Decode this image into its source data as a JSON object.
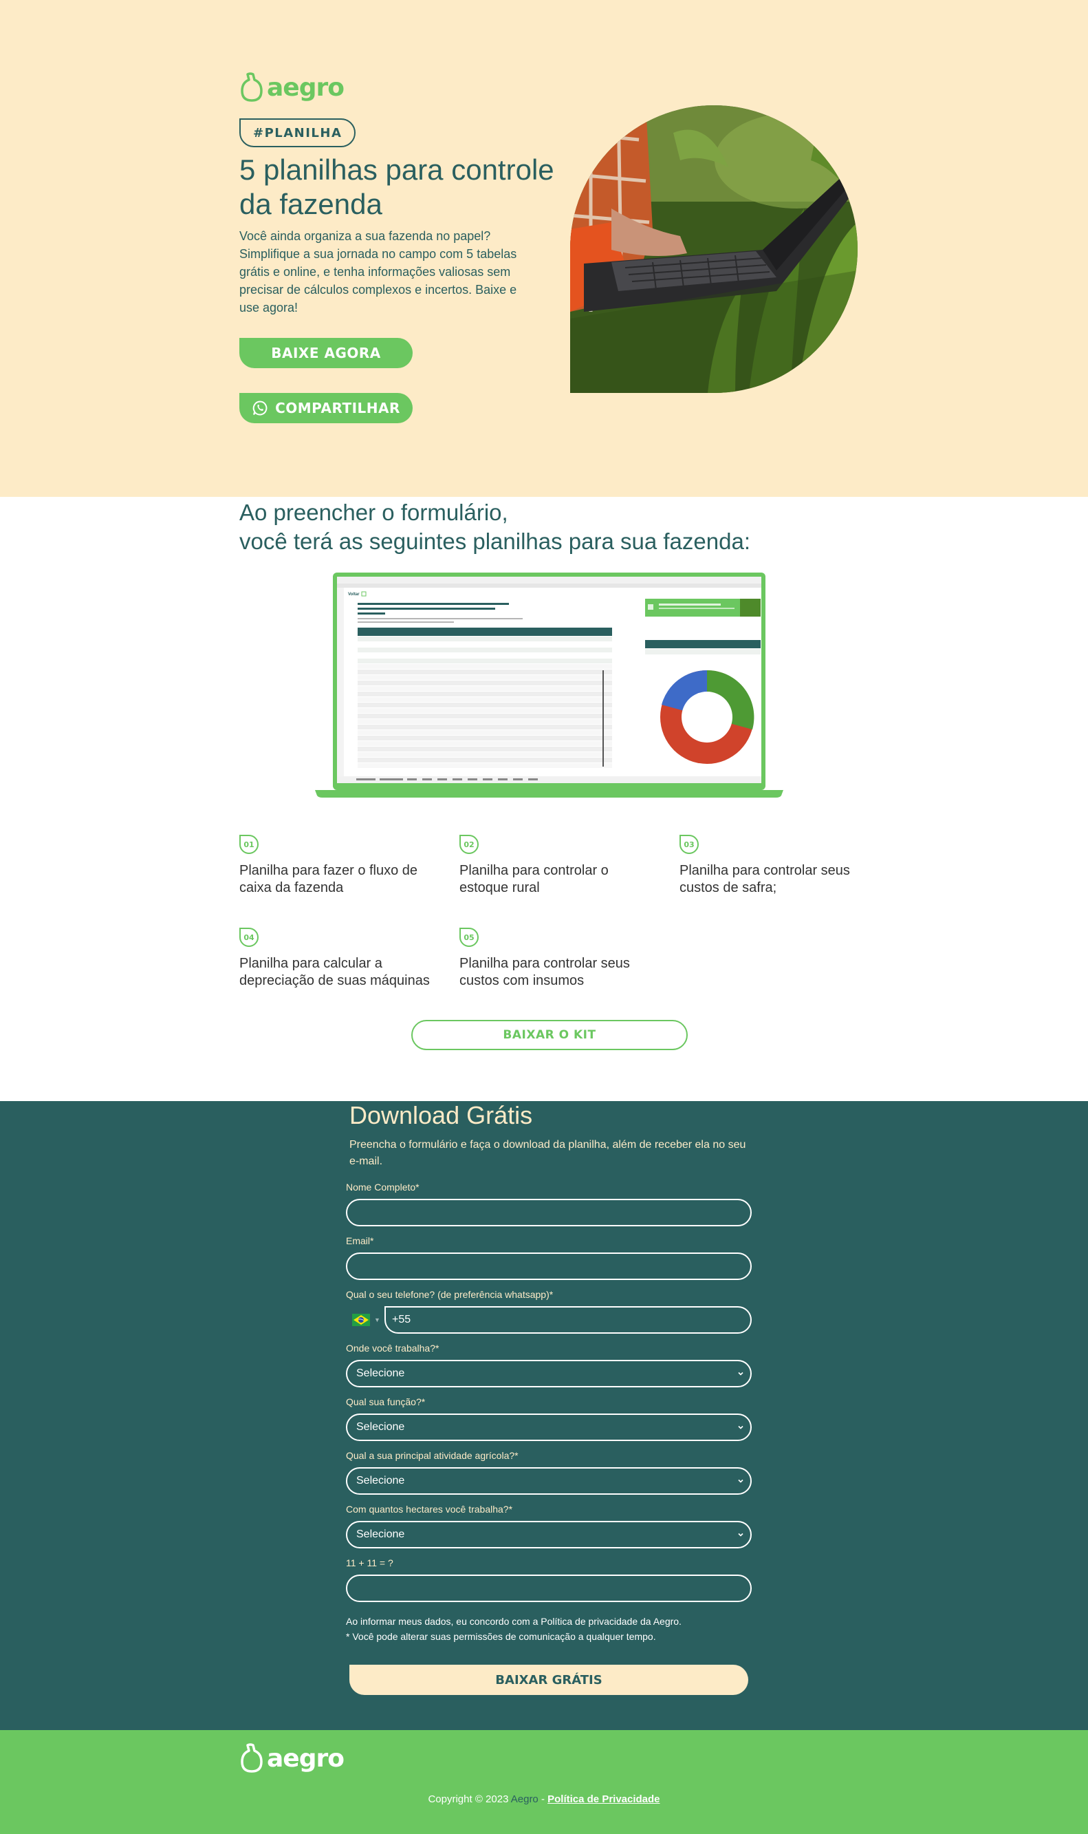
{
  "hero": {
    "logo": "aegro",
    "badge": "#PLANILHA",
    "title": "5 planilhas para controle da fazenda",
    "description": "Você ainda organiza a sua fazenda no papel? Simplifique a sua jornada no campo com 5 tabelas grátis e online, e tenha informações valiosas sem precisar de cálculos complexos e incertos. Baixe e use agora!",
    "download_button": "BAIXE AGORA",
    "share_button": "COMPARTILHAR"
  },
  "planilhas": {
    "title_line1": "Ao preencher o formulário,",
    "title_line2": "você terá as seguintes planilhas para sua fazenda:",
    "items": [
      {
        "num": "01",
        "text": "Planilha para fazer o fluxo de caixa da fazenda"
      },
      {
        "num": "02",
        "text": "Planilha para controlar o estoque rural"
      },
      {
        "num": "03",
        "text": "Planilha para controlar seus custos de safra;"
      },
      {
        "num": "04",
        "text": "Planilha para calcular a depreciação de suas máquinas"
      },
      {
        "num": "05",
        "text": "Planilha para controlar seus custos com insumos"
      }
    ],
    "kit_button": "BAIXAR O KIT"
  },
  "form": {
    "title": "Download Grátis",
    "description": "Preencha o formulário e faça o download da planilha, além de receber ela no seu e-mail.",
    "name_label": "Nome Completo*",
    "email_label": "Email*",
    "phone_label": "Qual o seu telefone? (de preferência whatsapp)*",
    "phone_value": "+55",
    "work_label": "Onde você trabalha?*",
    "role_label": "Qual sua função?*",
    "activity_label": "Qual a sua principal atividade agrícola?*",
    "hectares_label": "Com quantos hectares você trabalha?*",
    "select_placeholder": "Selecione",
    "captcha_label": "11 + 11 = ?",
    "legal_line1": "Ao informar meus dados, eu concordo com a Política de privacidade da Aegro.",
    "legal_line2": "* Você pode alterar suas permissões de comunicação a qualquer tempo.",
    "submit_button": "BAIXAR GRÁTIS"
  },
  "footer": {
    "logo": "aegro",
    "copyright": "Copyright © 2023",
    "brand": "Aegro",
    "separator": " - ",
    "policy_link": "Política de Privacidade"
  },
  "colors": {
    "cream": "#fdebc7",
    "teal": "#2a5f5f",
    "green": "#6bc760"
  }
}
